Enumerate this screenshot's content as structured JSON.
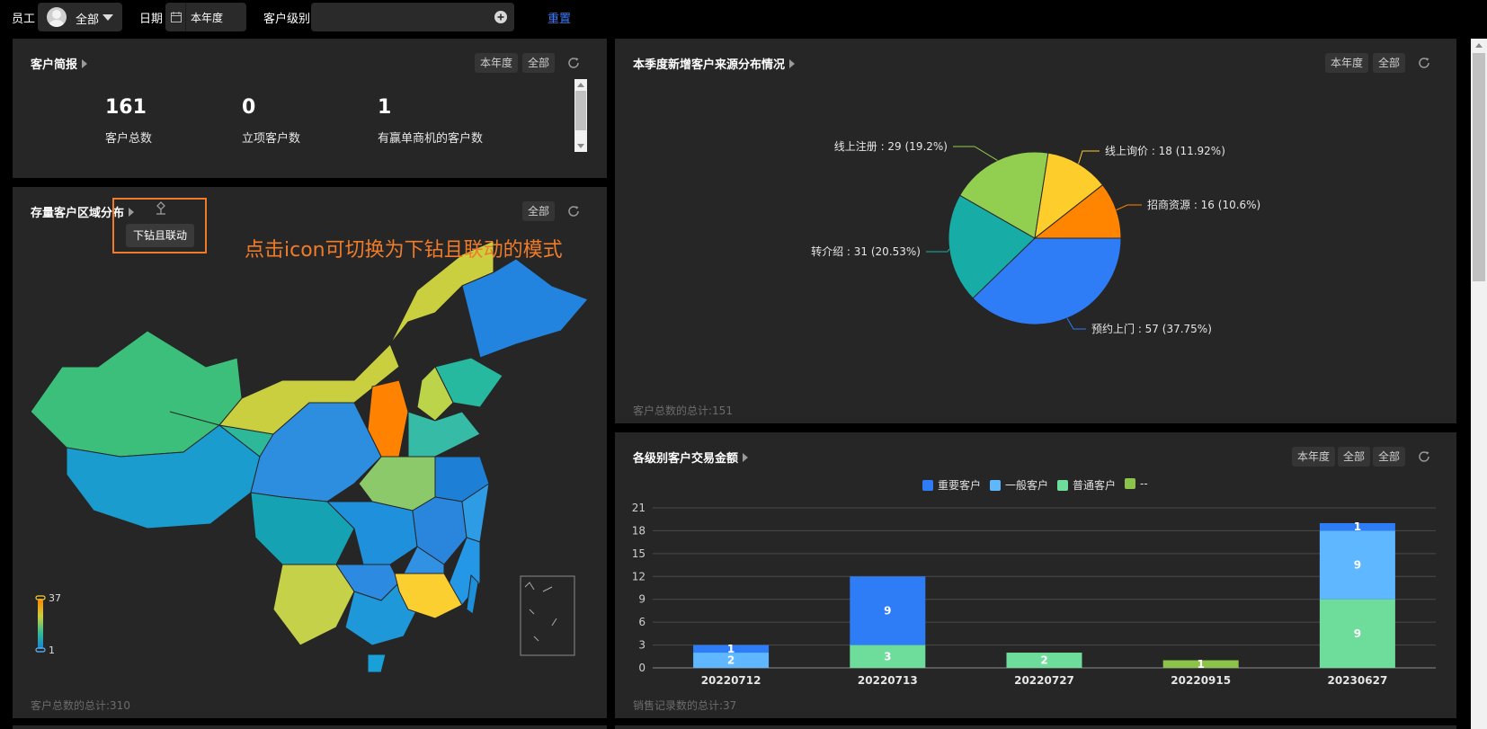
{
  "filters": {
    "employee_label": "员工",
    "employee_value": "全部",
    "date_label": "日期",
    "date_value": "本年度",
    "level_label": "客户级别",
    "level_value": "",
    "reset_label": "重置"
  },
  "brief": {
    "title": "客户简报",
    "chips": [
      "本年度",
      "全部"
    ],
    "kpis": [
      {
        "value": "161",
        "label": "客户总数"
      },
      {
        "value": "0",
        "label": "立项客户数"
      },
      {
        "value": "1",
        "label": "有赢单商机的客户数"
      }
    ]
  },
  "map_panel": {
    "title": "存量客户区域分布",
    "chip": "全部",
    "tooltip": "下钻且联动",
    "annotation": "点击icon可切换为下钻且联动的模式",
    "scale_max": "37",
    "scale_min": "1",
    "footnote": "客户总数的总计:310"
  },
  "source_panel": {
    "title": "本季度新增客户来源分布情况",
    "chips": [
      "本年度",
      "全部"
    ],
    "footnote": "客户总数的总计:151"
  },
  "amount_panel": {
    "title": "各级别客户交易金额",
    "chips": [
      "本年度",
      "全部",
      "全部"
    ],
    "footnote": "销售记录数的总计:37"
  },
  "colors": {
    "important": "#2e7cf6",
    "general": "#5fb8ff",
    "normal": "#6edc9a",
    "other": "#8cc34a",
    "accent": "#f07c2a",
    "link": "#3d7bf5"
  },
  "chart_data": [
    {
      "type": "pie",
      "title": "本季度新增客户来源分布情况",
      "slices": [
        {
          "name": "预约上门",
          "value": 57,
          "percent": 37.75,
          "label": "预约上门 : 57 (37.75%)",
          "color": "#2e7cf6"
        },
        {
          "name": "转介绍",
          "value": 31,
          "percent": 20.53,
          "label": "转介绍 : 31 (20.53%)",
          "color": "#17ada6"
        },
        {
          "name": "线上注册",
          "value": 29,
          "percent": 19.2,
          "label": "线上注册 : 29 (19.2%)",
          "color": "#92ce50"
        },
        {
          "name": "线上询价",
          "value": 18,
          "percent": 11.92,
          "label": "线上询价 : 18 (11.92%)",
          "color": "#fdcd2b"
        },
        {
          "name": "招商资源",
          "value": 16,
          "percent": 10.6,
          "label": "招商资源 : 16 (10.6%)",
          "color": "#ff8400"
        }
      ]
    },
    {
      "type": "bar",
      "stacked": true,
      "title": "各级别客户交易金额",
      "categories": [
        "20220712",
        "20220713",
        "20220727",
        "20220915",
        "20230627"
      ],
      "series": [
        {
          "name": "普通客户",
          "color": "#6edc9a",
          "values": [
            0,
            3,
            2,
            0,
            9
          ]
        },
        {
          "name": "一般客户",
          "color": "#5fb8ff",
          "values": [
            2,
            0,
            0,
            0,
            9
          ]
        },
        {
          "name": "重要客户",
          "color": "#2e7cf6",
          "values": [
            1,
            9,
            0,
            0,
            1
          ]
        },
        {
          "name": "--",
          "color": "#8cc34a",
          "values": [
            0,
            0,
            0,
            1,
            0
          ]
        }
      ],
      "legend_order": [
        "重要客户",
        "一般客户",
        "普通客户",
        "--"
      ],
      "y_ticks": [
        0,
        3,
        6,
        9,
        12,
        15,
        18,
        21
      ],
      "ylim": [
        0,
        21
      ],
      "grid": true,
      "legend_position": "top-center"
    }
  ]
}
